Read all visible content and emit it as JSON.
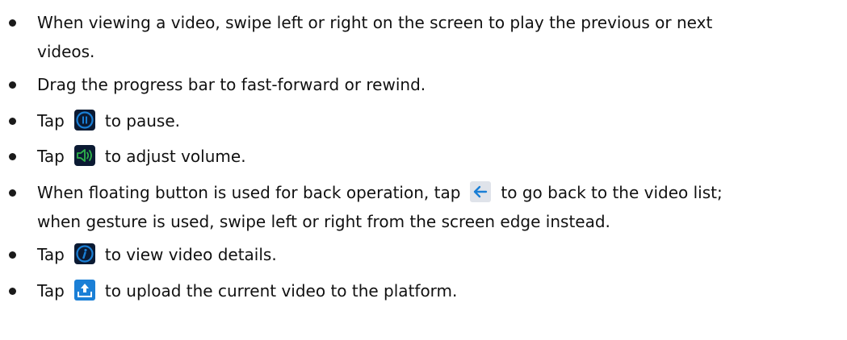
{
  "bullets": [
    {
      "line1": "When viewing a video, swipe left or right on the screen to play the previous or next",
      "line2": "videos."
    },
    {
      "text": "Drag the progress bar to fast-forward or rewind."
    },
    {
      "before": "Tap",
      "icon": "pause-icon",
      "after": "to pause."
    },
    {
      "before": "Tap",
      "icon": "volume-icon",
      "after": "to adjust volume."
    },
    {
      "before": "When floating button is used for back operation, tap",
      "icon": "back-arrow-icon",
      "after": "to go back to the video list;",
      "line2": "when gesture is used, swipe left or right from the screen edge instead."
    },
    {
      "before": "Tap",
      "icon": "info-icon",
      "after": "to view video details."
    },
    {
      "before": "Tap",
      "icon": "upload-icon",
      "after": "to upload the current video to the platform."
    }
  ],
  "colors": {
    "icon_bg": "#0b1a33",
    "icon_accent": "#1a7fd6",
    "volume_green": "#2fb24a"
  }
}
